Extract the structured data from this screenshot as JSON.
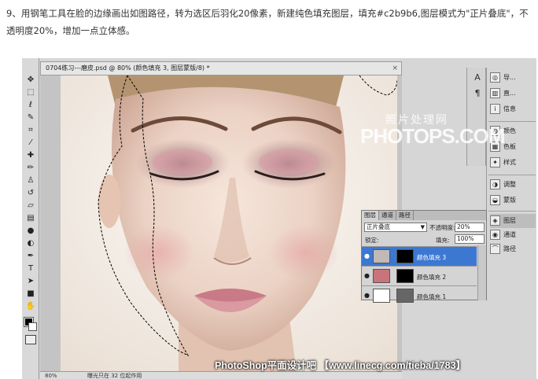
{
  "instruction": {
    "text": "9、用钢笔工具在脸的边缘画出如图路径，转为选区后羽化20像素，新建纯色填充图层，填充#c2b9b6,图层模式为\"正片叠底\"，不透明度20%，增加一点立体感。"
  },
  "document": {
    "title": "0704练习---磨皮.psd @ 80% (颜色填充 3, 图层蒙版/8) *",
    "close_glyph": "×",
    "zoom": "80%",
    "status": "曝光只在 32 位起作用"
  },
  "tools": [
    {
      "icon": "move-tool-icon",
      "glyph": "✥"
    },
    {
      "icon": "marquee-tool-icon",
      "glyph": "⬚"
    },
    {
      "icon": "lasso-tool-icon",
      "glyph": "ℓ"
    },
    {
      "icon": "quick-select-tool-icon",
      "glyph": "✎"
    },
    {
      "icon": "crop-tool-icon",
      "glyph": "⌗"
    },
    {
      "icon": "eyedropper-tool-icon",
      "glyph": "⁄"
    },
    {
      "icon": "healing-brush-tool-icon",
      "glyph": "✚"
    },
    {
      "icon": "brush-tool-icon",
      "glyph": "✏"
    },
    {
      "icon": "clone-stamp-tool-icon",
      "glyph": "♙"
    },
    {
      "icon": "history-brush-tool-icon",
      "glyph": "↺"
    },
    {
      "icon": "eraser-tool-icon",
      "glyph": "▱"
    },
    {
      "icon": "gradient-tool-icon",
      "glyph": "▤"
    },
    {
      "icon": "blur-tool-icon",
      "glyph": "●"
    },
    {
      "icon": "dodge-tool-icon",
      "glyph": "◐"
    },
    {
      "icon": "pen-tool-icon",
      "glyph": "✒"
    },
    {
      "icon": "type-tool-icon",
      "glyph": "T"
    },
    {
      "icon": "path-select-tool-icon",
      "glyph": "➤"
    },
    {
      "icon": "shape-tool-icon",
      "glyph": "■"
    },
    {
      "icon": "3d-rotate-tool-icon",
      "glyph": "⟲"
    },
    {
      "icon": "hand-tool-icon",
      "glyph": "✋"
    },
    {
      "icon": "zoom-tool-icon",
      "glyph": "🔍"
    }
  ],
  "mini_strip": [
    {
      "icon": "character-icon",
      "glyph": "A"
    },
    {
      "icon": "paragraph-icon",
      "glyph": "¶"
    }
  ],
  "dock": {
    "items": [
      {
        "icon": "navigator-icon",
        "glyph": "◎",
        "label": "导..."
      },
      {
        "icon": "histogram-icon",
        "glyph": "▥",
        "label": "直..."
      },
      {
        "icon": "info-icon",
        "glyph": "i",
        "label": "信息"
      },
      {
        "icon": "color-icon",
        "glyph": "◍",
        "label": "颜色"
      },
      {
        "icon": "swatches-icon",
        "glyph": "▦",
        "label": "色板"
      },
      {
        "icon": "styles-icon",
        "glyph": "✦",
        "label": "样式"
      },
      {
        "icon": "adjustments-icon",
        "glyph": "◑",
        "label": "调整"
      },
      {
        "icon": "masks-icon",
        "glyph": "◒",
        "label": "蒙版"
      },
      {
        "icon": "layers-icon",
        "glyph": "◈",
        "label": "图层"
      },
      {
        "icon": "channels-icon",
        "glyph": "◉",
        "label": "通道"
      },
      {
        "icon": "paths-icon",
        "glyph": "⌒",
        "label": "路径"
      }
    ]
  },
  "layers_panel": {
    "tabs": [
      "图层",
      "通道",
      "路径"
    ],
    "blend_mode": "正片叠底",
    "opacity_label": "不透明度:",
    "opacity_value": "20%",
    "lock_label": "锁定:",
    "fill_label": "填充:",
    "fill_value": "100%",
    "layers": [
      {
        "name": "颜色填充 3",
        "thumb_color": "#c2b9b6",
        "selected": true
      },
      {
        "name": "颜色填充 2",
        "thumb_color": "#c9747c",
        "selected": false
      },
      {
        "name": "颜色填充 1",
        "thumb_color": "#ffffff",
        "selected": false
      }
    ]
  },
  "watermarks": {
    "cn": "照片处理网",
    "en": "PHOTOPS.COM",
    "footer": "PhotoShop平面设计吧 【www.linecg.com/tieba/1783】"
  },
  "colors": {
    "selection_highlight": "#3c78d2",
    "fill_color_mentioned": "#c2b9b6"
  }
}
